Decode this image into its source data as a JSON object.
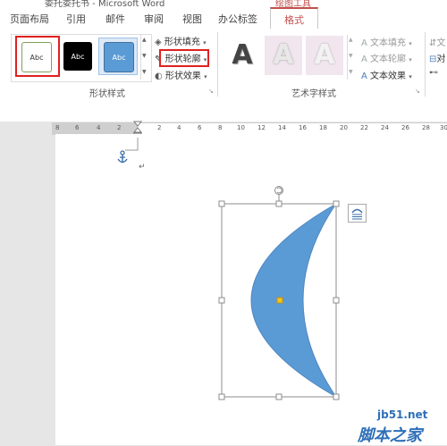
{
  "titlebar": {
    "title": "委托委托书 - Microsoft Word",
    "context_tab_group": "绘图工具"
  },
  "tabs": [
    "页面布局",
    "引用",
    "邮件",
    "审阅",
    "视图",
    "办公标签",
    "格式"
  ],
  "ribbon": {
    "shape_styles": {
      "thumbnails": [
        "Abc",
        "Abc",
        "Abc"
      ],
      "fill_label": "形状填充",
      "outline_label": "形状轮廓",
      "effects_label": "形状效果",
      "group_label": "形状样式"
    },
    "wordart": {
      "letters": [
        "A",
        "A",
        "A"
      ],
      "text_fill_label": "文本填充",
      "text_outline_label": "文本轮廓",
      "text_effects_label": "文本效果",
      "group_label": "艺术字样式"
    },
    "right_labels": [
      "文",
      "对"
    ]
  },
  "ruler": {
    "labels": [
      "8",
      "6",
      "4",
      "2",
      "2",
      "4",
      "6",
      "8",
      "10",
      "12",
      "14",
      "16",
      "18",
      "20",
      "22",
      "24",
      "26",
      "28",
      "30"
    ]
  },
  "document": {
    "paragraph_mark": "↵"
  },
  "watermark": {
    "site": "jb51.net",
    "brand": "脚本之家"
  },
  "colors": {
    "accent": "#c0504d",
    "highlight": "#e02020",
    "shape_fill": "#5b9bd5"
  }
}
